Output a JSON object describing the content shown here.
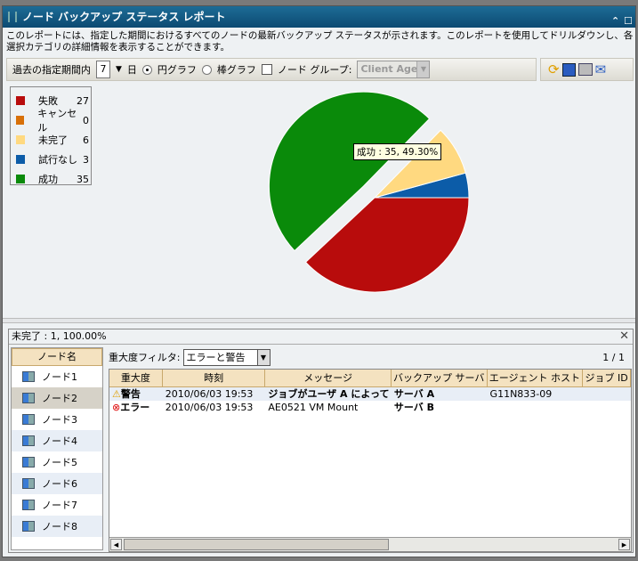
{
  "window": {
    "title": "ノード バックアップ ステータス レポート",
    "collapse_icon": "⌃",
    "maximize_icon": "☐"
  },
  "description": "このレポートには、指定した期間におけるすべてのノードの最新バックアップ ステータスが示されます。このレポートを使用してドリルダウンし、各選択カテゴリの詳細情報を表示することができます。",
  "toolbar": {
    "period_label": "過去の指定期間内",
    "period_value": "7",
    "day_label": "日",
    "pie_label": "円グラフ",
    "bar_label": "棒グラフ",
    "node_group_label": "ノード グループ:",
    "node_group_value": "Client Agent"
  },
  "legend": [
    {
      "label": "失敗",
      "value": 27,
      "color": "#b80c0c"
    },
    {
      "label": "キャンセル",
      "value": 0,
      "color": "#d87008"
    },
    {
      "label": "未完了",
      "value": 6,
      "color": "#ffd980"
    },
    {
      "label": "試行なし",
      "value": 3,
      "color": "#0c5ca8"
    },
    {
      "label": "成功",
      "value": 35,
      "color": "#0a8a0a"
    }
  ],
  "tooltip": "成功 : 35, 49.30%",
  "detail": {
    "header": "未完了 : 1, 100.00%",
    "node_column": "ノード名",
    "nodes": [
      "ノード1",
      "ノード2",
      "ノード3",
      "ノード4",
      "ノード5",
      "ノード6",
      "ノード7",
      "ノード8"
    ],
    "filter_label": "重大度フィルタ:",
    "filter_value": "エラーと警告",
    "page": "1 / 1",
    "columns": [
      "重大度",
      "時刻",
      "メッセージ",
      "バックアップ サーバ",
      "エージェント ホスト",
      "ジョブ ID"
    ],
    "rows": [
      {
        "severity": "警告",
        "time": "2010/06/03 19:53",
        "message": "ジョブがユーザ A によって",
        "server": "サーバ A",
        "host": "G11N833-09",
        "job": ""
      },
      {
        "severity": "エラー",
        "time": "2010/06/03 19:53",
        "message": "AE0521 VM Mount",
        "server": "サーバ B",
        "host": "",
        "job": ""
      }
    ]
  }
}
